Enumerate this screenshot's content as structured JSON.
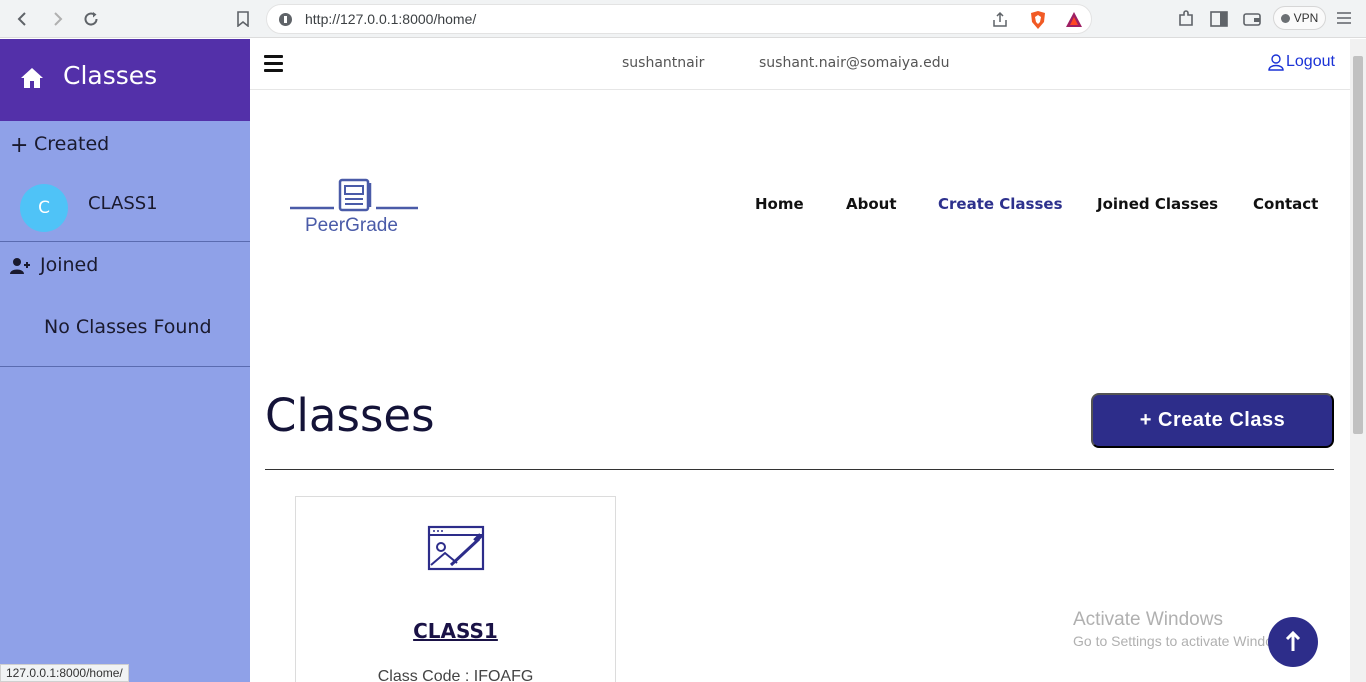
{
  "browser": {
    "url": "http://127.0.0.1:8000/home/",
    "vpn_label": "VPN",
    "status_url": "127.0.0.1:8000/home/"
  },
  "sidebar": {
    "title": "Classes",
    "created_label": "Created",
    "created_items": [
      {
        "avatar_letter": "C",
        "label": "CLASS1"
      }
    ],
    "joined_label": "Joined",
    "joined_empty": "No Classes Found"
  },
  "topbar": {
    "username": "sushantnair",
    "email": "sushant.nair@somaiya.edu",
    "logout_label": "Logout"
  },
  "logo": {
    "text": "PeerGrade"
  },
  "nav": [
    {
      "label": "Home"
    },
    {
      "label": "About"
    },
    {
      "label": "Create Classes",
      "active": true
    },
    {
      "label": "Joined Classes"
    },
    {
      "label": "Contact"
    }
  ],
  "main": {
    "title": "Classes",
    "create_button": "+ Create Class",
    "cards": [
      {
        "name": "CLASS1",
        "code": "Class Code : IFOAFG"
      }
    ]
  },
  "watermark": {
    "line1": "Activate Windows",
    "line2": "Go to Settings to activate Windows."
  },
  "colors": {
    "sidebar_bg": "#8fa1e8",
    "sidebar_header": "#5330a9",
    "accent": "#2d2d8a",
    "avatar": "#4fc3f7"
  }
}
